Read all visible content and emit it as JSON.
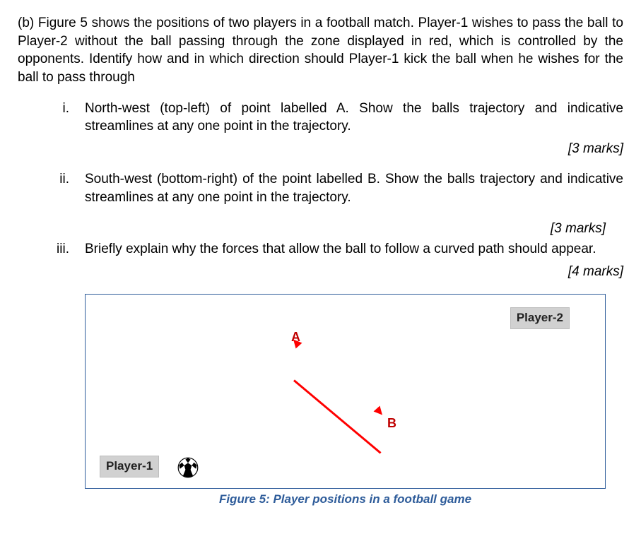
{
  "question": {
    "part_label": "(b)",
    "intro": "Figure 5 shows the positions of two players in a football match. Player-1 wishes to pass the ball to Player-2 without the ball passing through the zone displayed in red, which is controlled by the opponents. Identify how and in which direction should Player-1 kick the ball when he wishes for the ball to pass through"
  },
  "subparts": {
    "i": {
      "marker": "i.",
      "text": "North-west (top-left) of point labelled A. Show the balls trajectory and indicative streamlines at any one point in the trajectory.",
      "marks": "[3 marks]"
    },
    "ii": {
      "marker": "ii.",
      "text": "South-west (bottom-right) of the point labelled B. Show the balls trajectory and indicative streamlines at any one point in the trajectory.",
      "marks": "[3 marks]"
    },
    "iii": {
      "marker": "iii.",
      "text": "Briefly explain why the forces that allow the ball to follow a curved path should appear.",
      "marks": "[4 marks]"
    }
  },
  "figure": {
    "player1": "Player-1",
    "player2": "Player-2",
    "pointA": "A",
    "pointB": "B",
    "caption": "Figure 5: Player positions in a football game"
  }
}
